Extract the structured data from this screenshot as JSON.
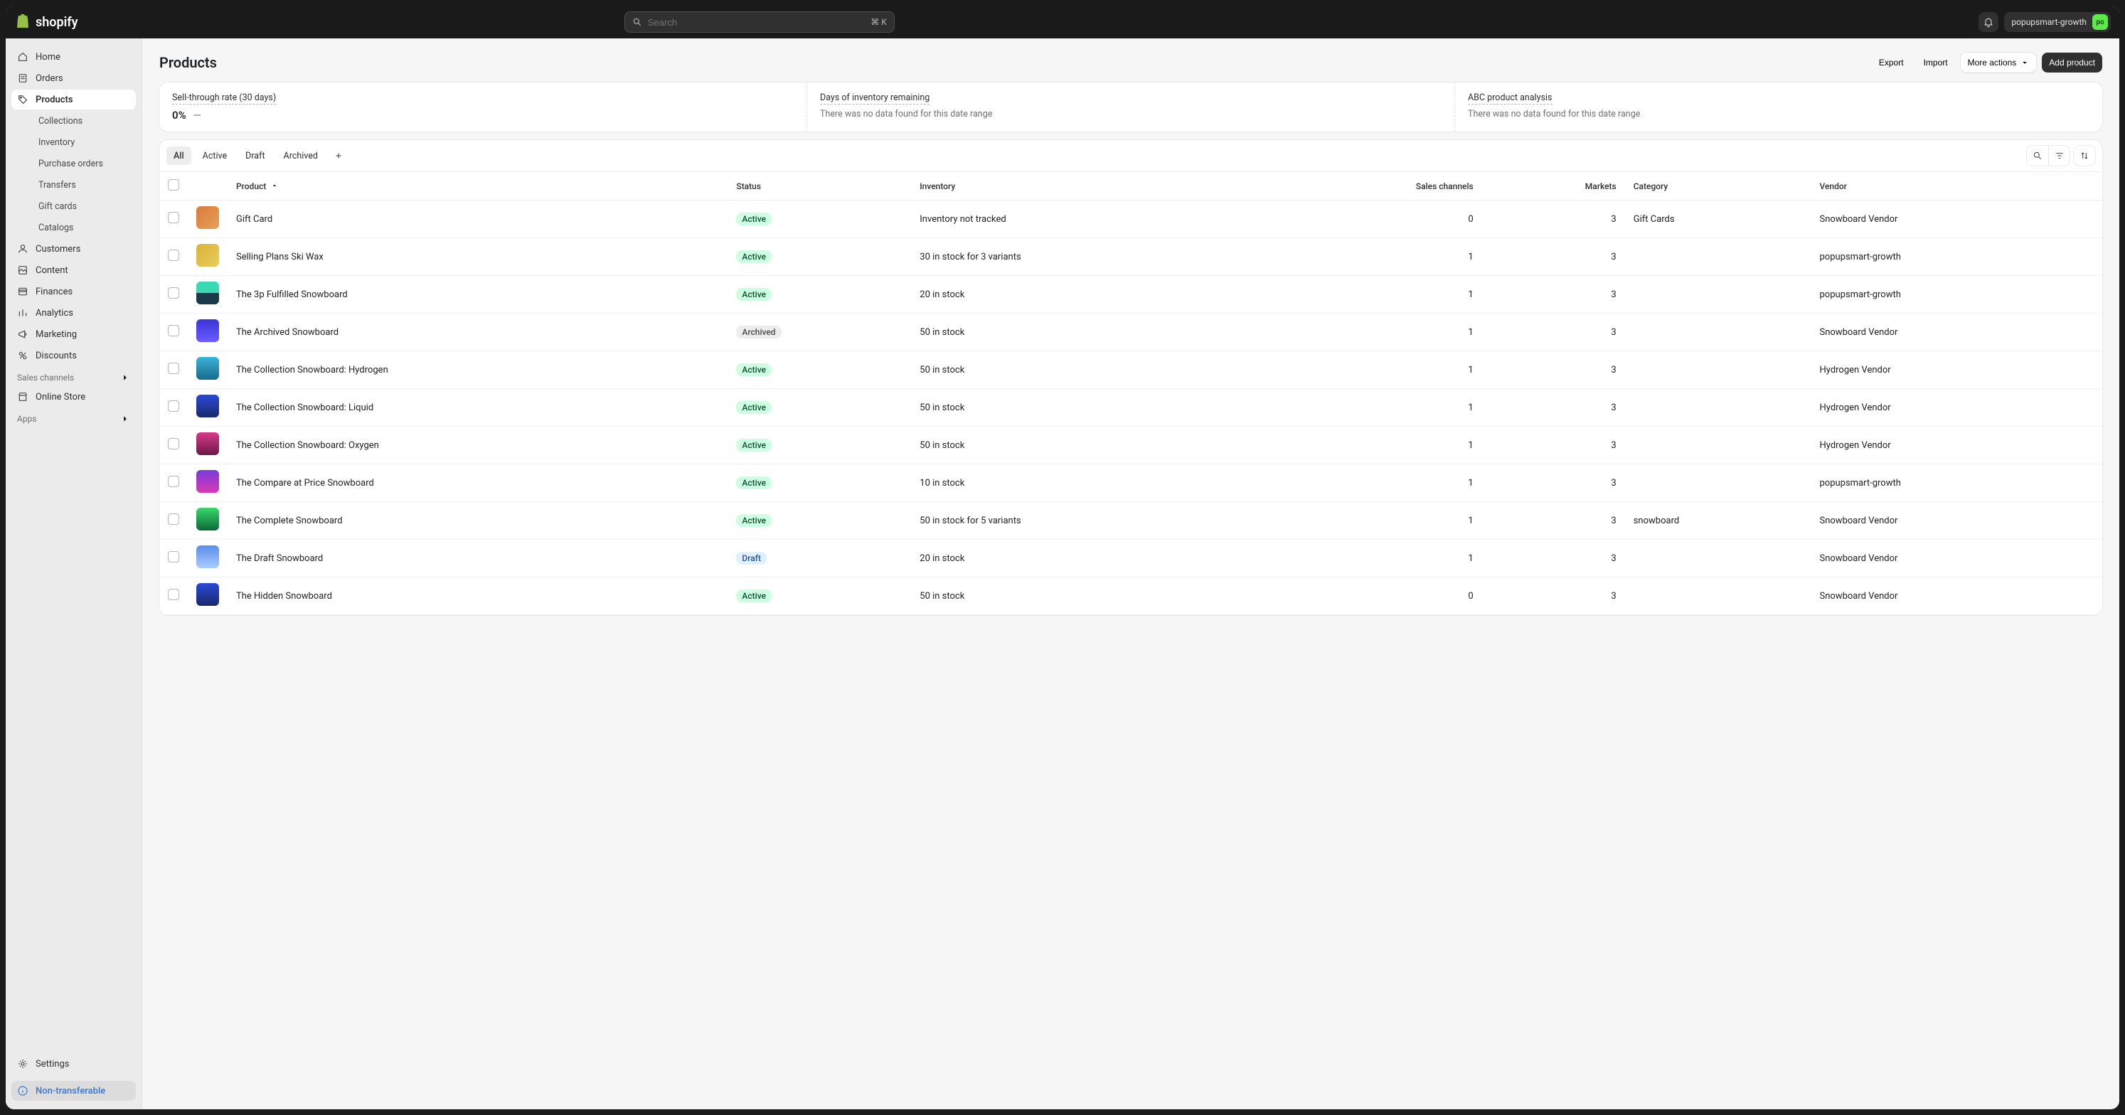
{
  "topbar": {
    "search_placeholder": "Search",
    "search_kbd": "⌘ K",
    "org_name": "popupsmart-growth",
    "avatar_initials": "po"
  },
  "sidebar": {
    "items": [
      {
        "label": "Home",
        "icon": "home-icon"
      },
      {
        "label": "Orders",
        "icon": "orders-icon"
      },
      {
        "label": "Products",
        "icon": "products-icon",
        "active": true
      },
      {
        "label": "Customers",
        "icon": "customers-icon"
      },
      {
        "label": "Content",
        "icon": "content-icon"
      },
      {
        "label": "Finances",
        "icon": "finances-icon"
      },
      {
        "label": "Analytics",
        "icon": "analytics-icon"
      },
      {
        "label": "Marketing",
        "icon": "marketing-icon"
      },
      {
        "label": "Discounts",
        "icon": "discounts-icon"
      }
    ],
    "products_sub": [
      {
        "label": "Collections"
      },
      {
        "label": "Inventory"
      },
      {
        "label": "Purchase orders"
      },
      {
        "label": "Transfers"
      },
      {
        "label": "Gift cards"
      },
      {
        "label": "Catalogs"
      }
    ],
    "channels_label": "Sales channels",
    "channels": [
      {
        "label": "Online Store",
        "icon": "store-icon"
      }
    ],
    "apps_label": "Apps",
    "settings_label": "Settings",
    "nontransferable_label": "Non-transferable"
  },
  "page": {
    "title": "Products",
    "actions": {
      "export": "Export",
      "import": "Import",
      "more": "More actions",
      "add": "Add product"
    }
  },
  "metrics": [
    {
      "label": "Sell-through rate (30 days)",
      "value": "0%",
      "delta": "—",
      "sub": ""
    },
    {
      "label": "Days of inventory remaining",
      "value": "",
      "sub": "There was no data found for this date range"
    },
    {
      "label": "ABC product analysis",
      "value": "",
      "sub": "There was no data found for this date range"
    }
  ],
  "table": {
    "tabs": [
      {
        "label": "All",
        "active": true
      },
      {
        "label": "Active"
      },
      {
        "label": "Draft"
      },
      {
        "label": "Archived"
      }
    ],
    "columns": {
      "product": "Product",
      "status": "Status",
      "inventory": "Inventory",
      "sales_channels": "Sales channels",
      "markets": "Markets",
      "category": "Category",
      "vendor": "Vendor"
    },
    "rows": [
      {
        "thumb": "orange",
        "product": "Gift Card",
        "status": "Active",
        "inventory": "Inventory not tracked",
        "channels": "0",
        "markets": "3",
        "category": "Gift Cards",
        "vendor": "Snowboard Vendor"
      },
      {
        "thumb": "yellow",
        "product": "Selling Plans Ski Wax",
        "status": "Active",
        "inventory": "30 in stock for 3 variants",
        "channels": "1",
        "markets": "3",
        "category": "",
        "vendor": "popupsmart-growth"
      },
      {
        "thumb": "teal",
        "product": "The 3p Fulfilled Snowboard",
        "status": "Active",
        "inventory": "20 in stock",
        "channels": "1",
        "markets": "3",
        "category": "",
        "vendor": "popupsmart-growth"
      },
      {
        "thumb": "purple",
        "product": "The Archived Snowboard",
        "status": "Archived",
        "inventory": "50 in stock",
        "channels": "1",
        "markets": "3",
        "category": "",
        "vendor": "Snowboard Vendor"
      },
      {
        "thumb": "cyan",
        "product": "The Collection Snowboard: Hydrogen",
        "status": "Active",
        "inventory": "50 in stock",
        "channels": "1",
        "markets": "3",
        "category": "",
        "vendor": "Hydrogen Vendor"
      },
      {
        "thumb": "blue",
        "product": "The Collection Snowboard: Liquid",
        "status": "Active",
        "inventory": "50 in stock",
        "channels": "1",
        "markets": "3",
        "category": "",
        "vendor": "Hydrogen Vendor"
      },
      {
        "thumb": "pink",
        "product": "The Collection Snowboard: Oxygen",
        "status": "Active",
        "inventory": "50 in stock",
        "channels": "1",
        "markets": "3",
        "category": "",
        "vendor": "Hydrogen Vendor"
      },
      {
        "thumb": "violet",
        "product": "The Compare at Price Snowboard",
        "status": "Active",
        "inventory": "10 in stock",
        "channels": "1",
        "markets": "3",
        "category": "",
        "vendor": "popupsmart-growth"
      },
      {
        "thumb": "green",
        "product": "The Complete Snowboard",
        "status": "Active",
        "inventory": "50 in stock for 5 variants",
        "channels": "1",
        "markets": "3",
        "category": "snowboard",
        "vendor": "Snowboard Vendor"
      },
      {
        "thumb": "sky",
        "product": "The Draft Snowboard",
        "status": "Draft",
        "inventory": "20 in stock",
        "channels": "1",
        "markets": "3",
        "category": "",
        "vendor": "Snowboard Vendor"
      },
      {
        "thumb": "blue",
        "product": "The Hidden Snowboard",
        "status": "Active",
        "inventory": "50 in stock",
        "channels": "0",
        "markets": "3",
        "category": "",
        "vendor": "Snowboard Vendor"
      }
    ]
  }
}
